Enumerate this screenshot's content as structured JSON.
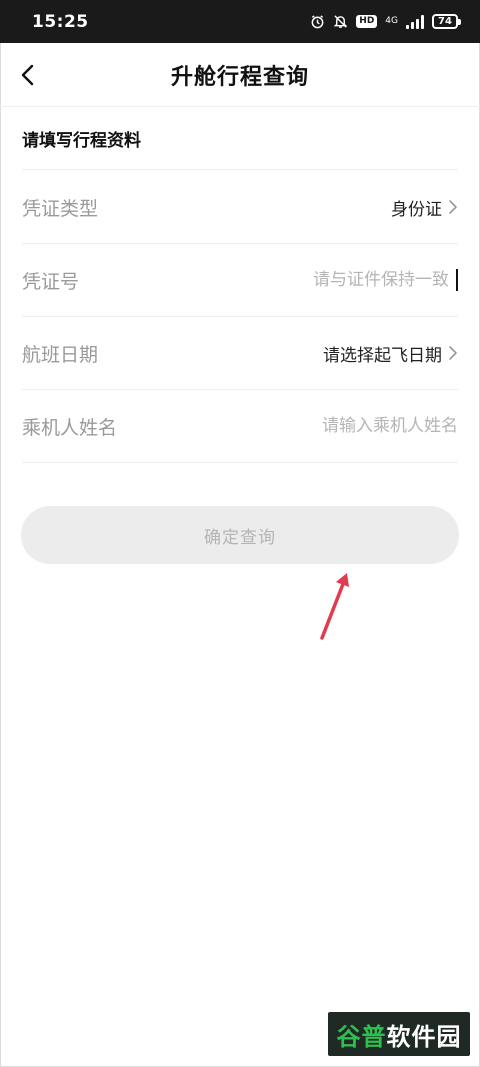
{
  "status_bar": {
    "time": "15:25",
    "hd": "HD",
    "network": "4G",
    "battery": "74"
  },
  "nav": {
    "title": "升舱行程查询",
    "back_icon": "chevron-left-icon"
  },
  "form": {
    "section_title": "请填写行程资料",
    "rows": [
      {
        "label": "凭证类型",
        "value": "身份证",
        "type": "select"
      },
      {
        "label": "凭证号",
        "placeholder": "请与证件保持一致",
        "type": "input"
      },
      {
        "label": "航班日期",
        "value": "请选择起飞日期",
        "type": "select"
      },
      {
        "label": "乘机人姓名",
        "placeholder": "请输入乘机人姓名",
        "type": "input"
      }
    ],
    "submit_label": "确定查询"
  },
  "annotation": {
    "color": "#e23a4e"
  },
  "watermark": {
    "part_a": "谷普",
    "part_b": "软件园"
  },
  "colors": {
    "status_bg": "#1a1a1a",
    "button_disabled_bg": "#ececec",
    "button_disabled_text": "#b4b4b4"
  }
}
